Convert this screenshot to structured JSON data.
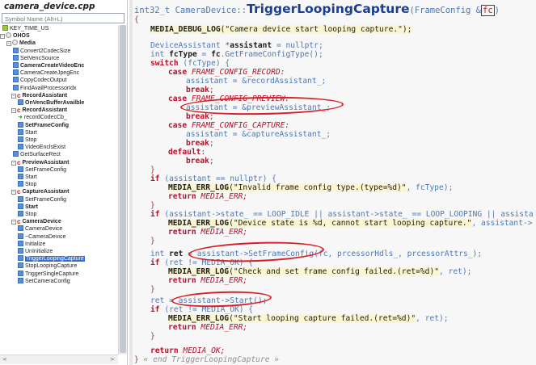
{
  "file_title": "camera_device.cpp",
  "search": {
    "placeholder": "Symbol Name (Alt+L)"
  },
  "tree": [
    {
      "text": "KEY_TIME_US",
      "kind": "var"
    },
    {
      "text": "OHOS",
      "kind": "ns",
      "bold": true
    },
    {
      "text": "Media",
      "kind": "ns",
      "bold": true
    },
    {
      "text": "Convert2CodecSize",
      "kind": "func"
    },
    {
      "text": "SetVencSource",
      "kind": "func"
    },
    {
      "text": "CameraCreateVideoEnc",
      "kind": "func",
      "bold": true
    },
    {
      "text": "CameraCreateJpegEnc",
      "kind": "func"
    },
    {
      "text": "CopyCodecOutput",
      "kind": "func"
    },
    {
      "text": "FindAvailProcessorIdx",
      "kind": "func"
    },
    {
      "text": "RecordAssistant",
      "kind": "class",
      "bold": true
    },
    {
      "text": "OnVencBufferAvailble",
      "kind": "func",
      "bold": true
    },
    {
      "text": "RecordAssistant",
      "kind": "class",
      "bold": true
    },
    {
      "text": "recordCodecCb_",
      "kind": "arrow"
    },
    {
      "text": "SetFrameConfig",
      "kind": "func",
      "bold": true
    },
    {
      "text": "Start",
      "kind": "func"
    },
    {
      "text": "Stop",
      "kind": "func"
    },
    {
      "text": "VideoEnclsExist",
      "kind": "func"
    },
    {
      "text": "GetSurfaceRect",
      "kind": "func"
    },
    {
      "text": "PreviewAssistant",
      "kind": "class",
      "bold": true
    },
    {
      "text": "SetFrameConfig",
      "kind": "func"
    },
    {
      "text": "Start",
      "kind": "func"
    },
    {
      "text": "Stop",
      "kind": "func"
    },
    {
      "text": "CaptureAssistant",
      "kind": "class",
      "bold": true
    },
    {
      "text": "SetFrameConfig",
      "kind": "func"
    },
    {
      "text": "Start",
      "kind": "func",
      "bold": true
    },
    {
      "text": "Stop",
      "kind": "func"
    },
    {
      "text": "CameraDevice",
      "kind": "class",
      "bold": true
    },
    {
      "text": "CameraDevice",
      "kind": "func"
    },
    {
      "text": "~CameraDevice",
      "kind": "func"
    },
    {
      "text": "Initialize",
      "kind": "func"
    },
    {
      "text": "UnInitialize",
      "kind": "func"
    },
    {
      "text": "TriggerLoopingCapture",
      "kind": "func",
      "selected": true
    },
    {
      "text": "StopLoopingCapture",
      "kind": "func"
    },
    {
      "text": "TriggerSingleCapture",
      "kind": "func"
    },
    {
      "text": "SetCameraConfig",
      "kind": "func"
    }
  ],
  "code": {
    "sig_prefix": "int32_t CameraDevice::",
    "sig_name": "TriggerLoopingCapture",
    "sig_params_open": "(FrameConfig &",
    "sig_param": "fc",
    "sig_close": ")",
    "line_01": "{",
    "line_02_macro": "MEDIA_DEBUG_LOG",
    "line_02_str": "(\"Camera device start looping capture.\");",
    "line_03_type": "DeviceAssistant",
    "line_03_a": " *",
    "line_03_b": "assistant",
    "line_03_c": " = nullptr;",
    "line_04_type": "int",
    "line_04_a": "fcType",
    "line_04_b": " = ",
    "line_04_c": "fc",
    "line_04_d": ".GetFrameConfigType();",
    "line_05_kw": "switch",
    "line_05_rest": " (fcType) {",
    "line_06_kw": "case",
    "line_06_rest": " FRAME_CONFIG_RECORD:",
    "line_07": "assistant = &recordAssistant_;",
    "line_08_kw": "break",
    "line_08_rest": ";",
    "line_09_kw": "case",
    "line_09_rest": " FRAME_CONFIG_PREVIEW:",
    "line_10": "assistant = &previewAssistant_;",
    "line_11_kw": "break",
    "line_11_rest": ";",
    "line_12_kw": "case",
    "line_12_rest": " FRAME_CONFIG_CAPTURE:",
    "line_13": "assistant = &captureAssistant_;",
    "line_14_kw": "break",
    "line_14_rest": ";",
    "line_15_kw": "default",
    "line_15_rest": ":",
    "line_16_kw": "break",
    "line_16_rest": ";",
    "line_17": "}",
    "line_18_kw": "if",
    "line_18_rest": " (assistant == nullptr) {",
    "line_19_macro": "MEDIA_ERR_LOG",
    "line_19_str": "(\"Invalid frame config type.(type=%d)\"",
    "line_19_rest": ", fcType);",
    "line_20_kw": "return",
    "line_20_rest": " MEDIA_ERR;",
    "line_21": "}",
    "line_22_kw": "if",
    "line_22_rest": " (assistant->state_ == LOOP_IDLE || assistant->state_ == LOOP_LOOPING || assista",
    "line_23_macro": "MEDIA_ERR_LOG",
    "line_23_str": "(\"Device state is %d, cannot start looping capture.\"",
    "line_23_rest": ", assistant->",
    "line_24_kw": "return",
    "line_24_rest": " MEDIA_ERR;",
    "line_25": "}",
    "line_26_type": "int",
    "line_26_a": "ret",
    "line_26_b": " = assistant->SetFrameConfig(fc, prcessorHdls_, prcessorAttrs_);",
    "line_27_kw": "if",
    "line_27_rest": " (ret != MEDIA_OK) {",
    "line_28_macro": "MEDIA_ERR_LOG",
    "line_28_str": "(\"Check and set frame config failed.(ret=%d)\"",
    "line_28_rest": ", ret);",
    "line_29_kw": "return",
    "line_29_rest": " MEDIA_ERR;",
    "line_30": "}",
    "line_31_a": "ret",
    "line_31_b": " = assistant->Start();",
    "line_32_kw": "if",
    "line_32_rest": " (ret != MEDIA_OK) {",
    "line_33_macro": "MEDIA_ERR_LOG",
    "line_33_str": "(\"Start looping capture failed.(ret=%d)\"",
    "line_33_rest": ", ret);",
    "line_34_kw": "return",
    "line_34_rest": " MEDIA_ERR;",
    "line_35": "}",
    "line_36_kw": "return",
    "line_36_rest": " MEDIA_OK;",
    "line_37_brace": "}",
    "line_37_cmt": " « end TriggerLoopingCapture »"
  },
  "colors": {
    "selection": "#2f6fd6",
    "annotation": "#d81f26",
    "keyword": "#b5112b",
    "string_bg": "#fbf6cf"
  }
}
